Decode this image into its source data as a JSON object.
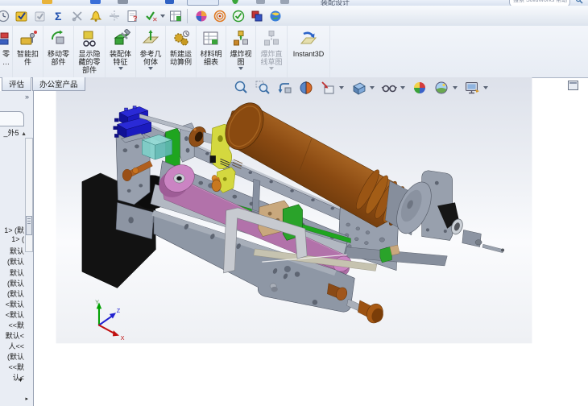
{
  "window": {
    "title_fragment": "装配设计",
    "search_placeholder": "搜索 SolidWorks 帮助"
  },
  "toolbar_icons": [
    "history-clock",
    "verify-box",
    "checkbox",
    "equations-sigma",
    "no-sketch",
    "alert-bell",
    "symmetry",
    "help-document",
    "check-wand",
    "dropdown",
    "design-table",
    "render-ball",
    "target-rings",
    "approve-check",
    "compare-squares",
    "world-sphere"
  ],
  "command_manager": {
    "buttons": [
      {
        "label": "零\n…"
      },
      {
        "label": "智能扣\n件"
      },
      {
        "label": "移动零\n部件"
      },
      {
        "label": "显示隐\n藏的零\n部件"
      },
      {
        "label": "装配体\n特征",
        "dropdown": true
      },
      {
        "label": "参考几\n何体",
        "dropdown": true
      },
      {
        "label": "新建运\n动算例"
      },
      {
        "label": "材料明\n细表"
      },
      {
        "label": "爆炸视\n图",
        "dropdown": true
      },
      {
        "label": "爆炸直\n线草图",
        "dropdown": true,
        "disabled": true
      },
      {
        "label": "Instant3D"
      }
    ]
  },
  "tabs": [
    {
      "label": "评估"
    },
    {
      "label": "办公室产品"
    }
  ],
  "headsup_icons": [
    "zoom-to-fit",
    "zoom-to-area",
    "previous-view",
    "section-view",
    "view-orientation",
    "display-style",
    "hide-show-items",
    "edit-appearance",
    "apply-scene",
    "view-settings"
  ],
  "feature_tree": {
    "expand_chevron": "»",
    "root_fragment": "_外5",
    "root_arrow": "▲",
    "items": [
      "1> (默",
      "1> (",
      "默认",
      "(默认",
      "默认",
      "(默认",
      "(默认",
      "<默认",
      "<默认",
      "<<默",
      "默认<",
      "人<<",
      "(默认",
      "<<默",
      "认<"
    ],
    "overflow_down": "▼",
    "resize_mark": "▸"
  },
  "viewport": {
    "triad": {
      "x": "X",
      "y": "Y",
      "z": "Z"
    },
    "colors": {
      "frame_gray": "#98a0ae",
      "frame_light": "#b2b8c2",
      "frame_dark": "#6e7584",
      "motor_brown": "#8a4a10",
      "motor_highlight": "#b4702a",
      "belt_pink": "#b272aa",
      "pulley_pink": "#cb84c3",
      "green": "#1fa51f",
      "blue_bracket": "#2a2ad6",
      "cyan": "#7fcfc9",
      "yellow": "#d4d83f",
      "tan": "#c9a87d",
      "black_part": "#121212",
      "orange_brass": "#c87820",
      "knob_brown": "#9c5212",
      "light_bracket": "#c7cad0"
    }
  }
}
